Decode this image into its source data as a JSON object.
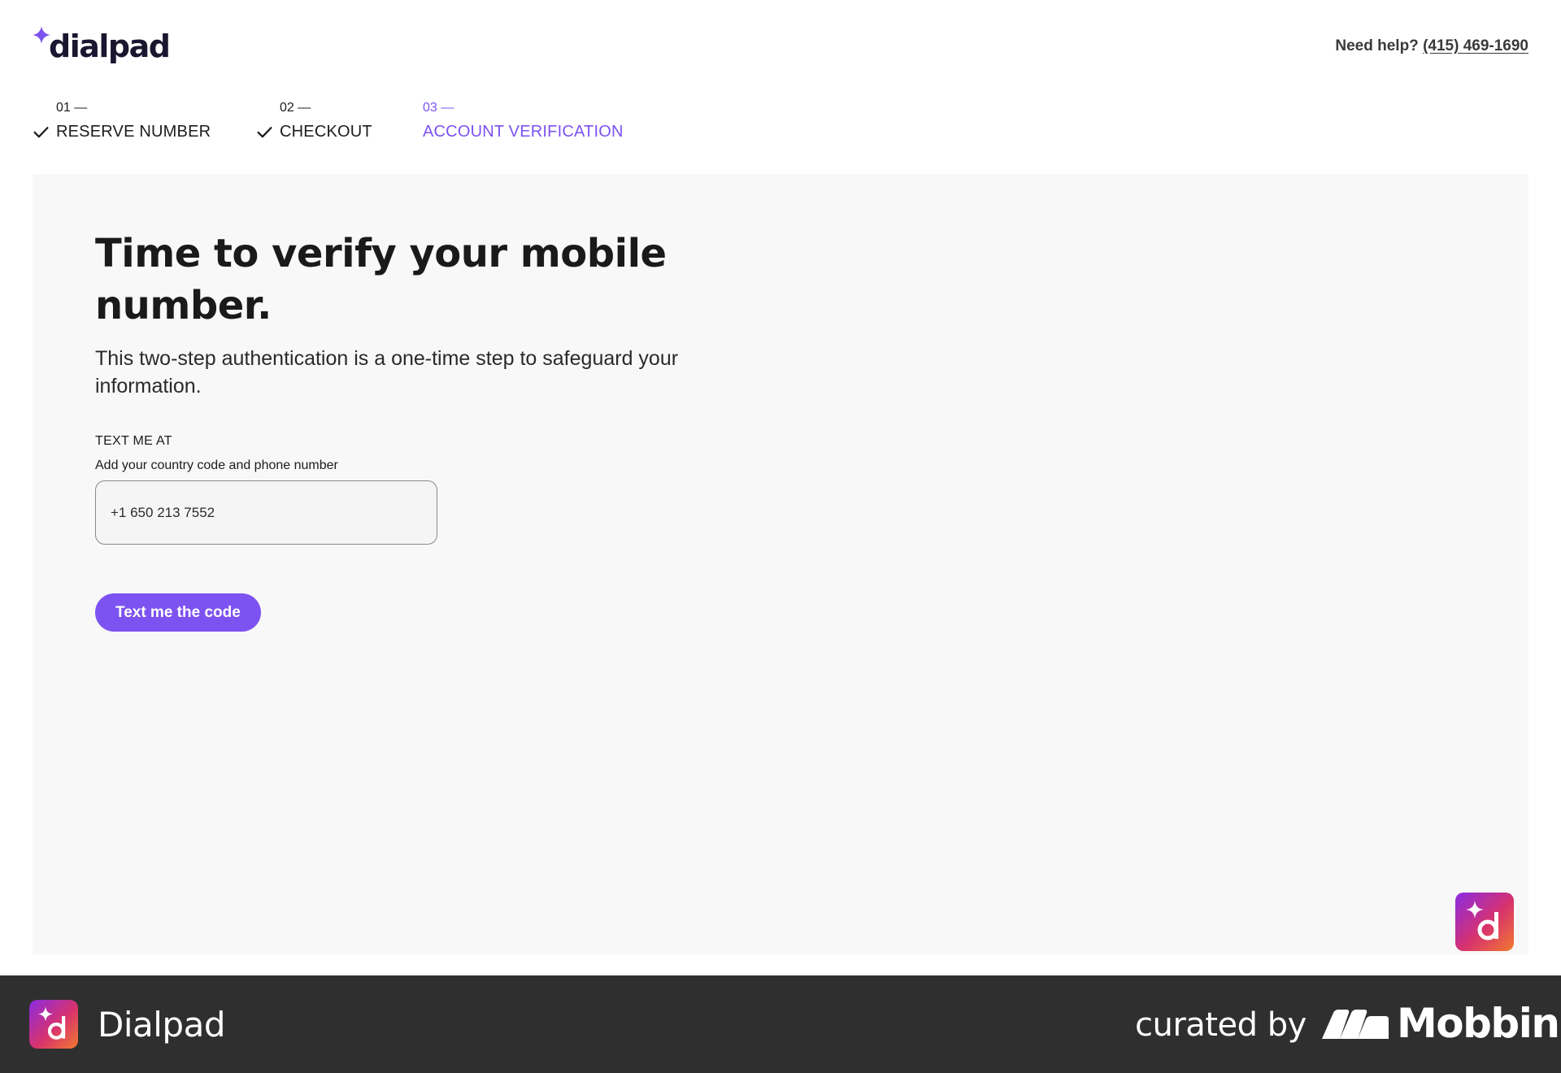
{
  "header": {
    "logo_text": "dialpad",
    "logo_icon": "sparkle-icon",
    "help_prefix": "Need help?",
    "help_phone": "(415) 469-1690"
  },
  "steps": [
    {
      "number": "01 —",
      "label": "RESERVE NUMBER",
      "status": "complete"
    },
    {
      "number": "02 —",
      "label": "CHECKOUT",
      "status": "complete"
    },
    {
      "number": "03 —",
      "label": "ACCOUNT VERIFICATION",
      "status": "active"
    }
  ],
  "main": {
    "title": "Time to verify your mobile number.",
    "subtitle": "This two-step authentication is a one-time step to safeguard your information.",
    "field_label": "TEXT ME AT",
    "field_help": "Add your country code and phone number",
    "phone_value": "+1 650 213 7552",
    "cta_label": "Text me the code"
  },
  "footer": {
    "app_name": "Dialpad",
    "curated_by": "curated by",
    "brand": "Mobbin"
  },
  "colors": {
    "accent": "#7c52f0",
    "panel_bg": "#f8f8f8",
    "footer_bg": "#2f2f2f",
    "text": "#1c1c1e"
  }
}
